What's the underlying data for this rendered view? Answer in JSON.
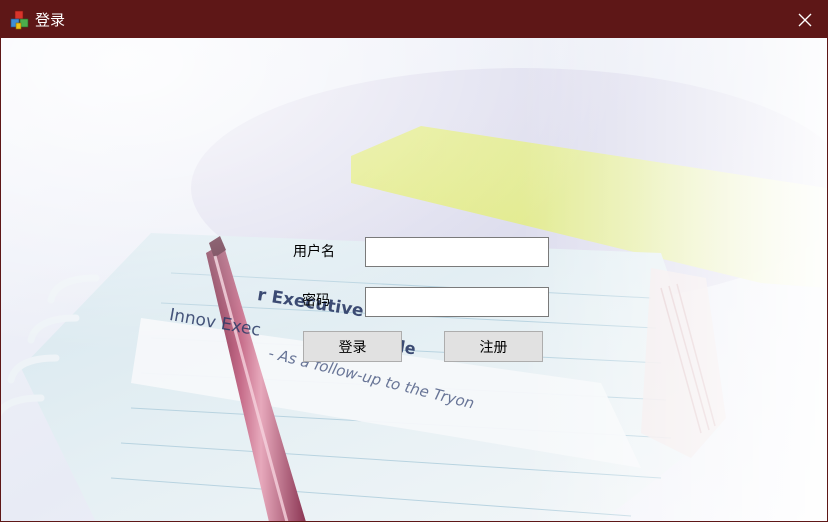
{
  "window": {
    "title": "登录",
    "accent_color": "#5e1717"
  },
  "form": {
    "username_label": "用户名",
    "username_value": "",
    "password_label": "密码",
    "password_value": "",
    "login_button": "登录",
    "register_button": "注册"
  },
  "background": {
    "document_text_1": "r Executive",
    "document_text_2": "Innov Exec",
    "document_text_3": "le",
    "document_text_4": "- As a follow-up to the Tryon"
  },
  "icons": {
    "app": "app-cubes-icon",
    "close": "close-icon"
  }
}
